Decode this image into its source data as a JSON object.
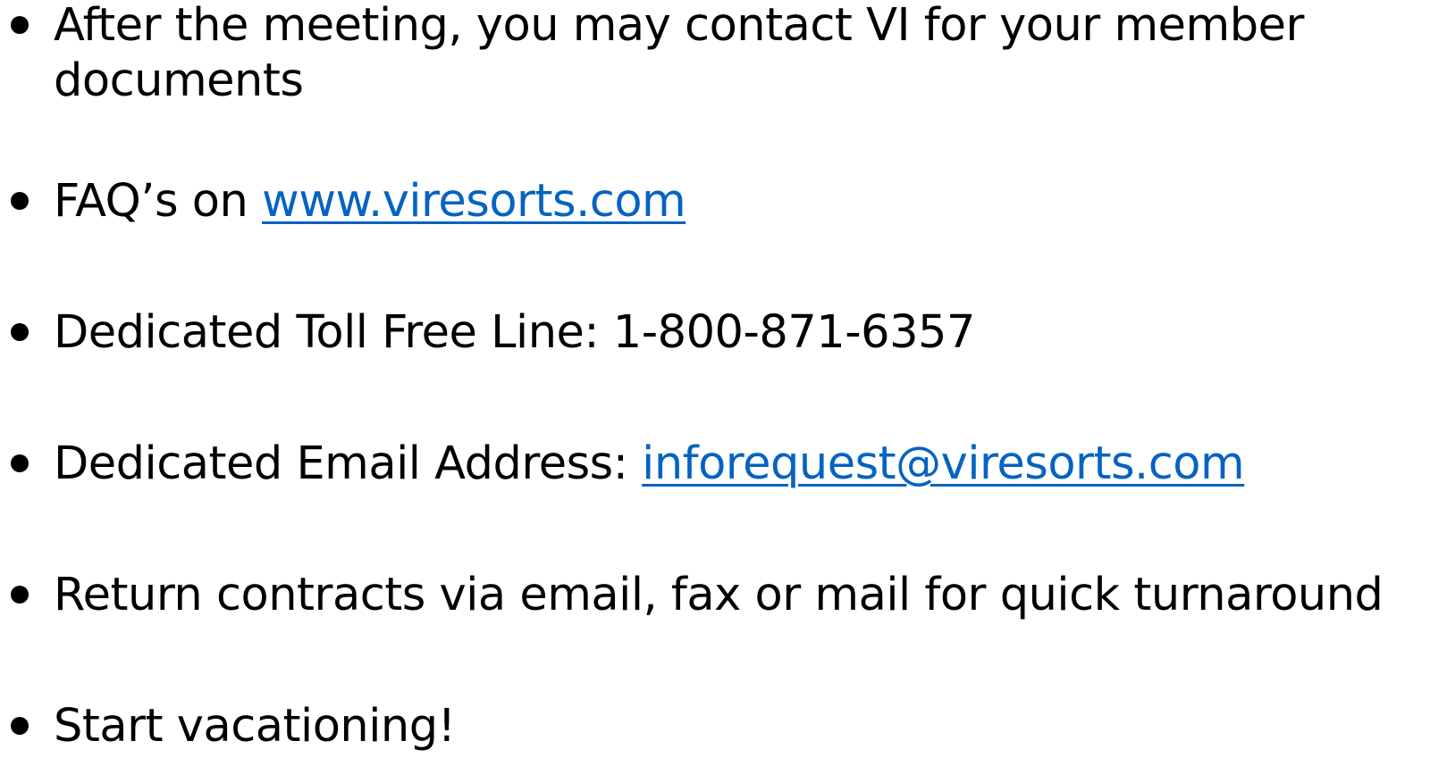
{
  "bullets": [
    {
      "text": "After the meeting, you may contact VI for your member documents"
    },
    {
      "prefix": "FAQ’s on ",
      "link_text": "www.viresorts.com"
    },
    {
      "text": "Dedicated Toll Free Line: 1-800-871-6357"
    },
    {
      "prefix": "Dedicated Email Address: ",
      "link_text": "inforequest@viresorts.com"
    },
    {
      "text": "Return contracts via email, fax or mail for quick turnaround"
    },
    {
      "text": "Start vacationing!"
    }
  ],
  "colors": {
    "text": "#000000",
    "link": "#0563c1",
    "background": "#ffffff"
  }
}
